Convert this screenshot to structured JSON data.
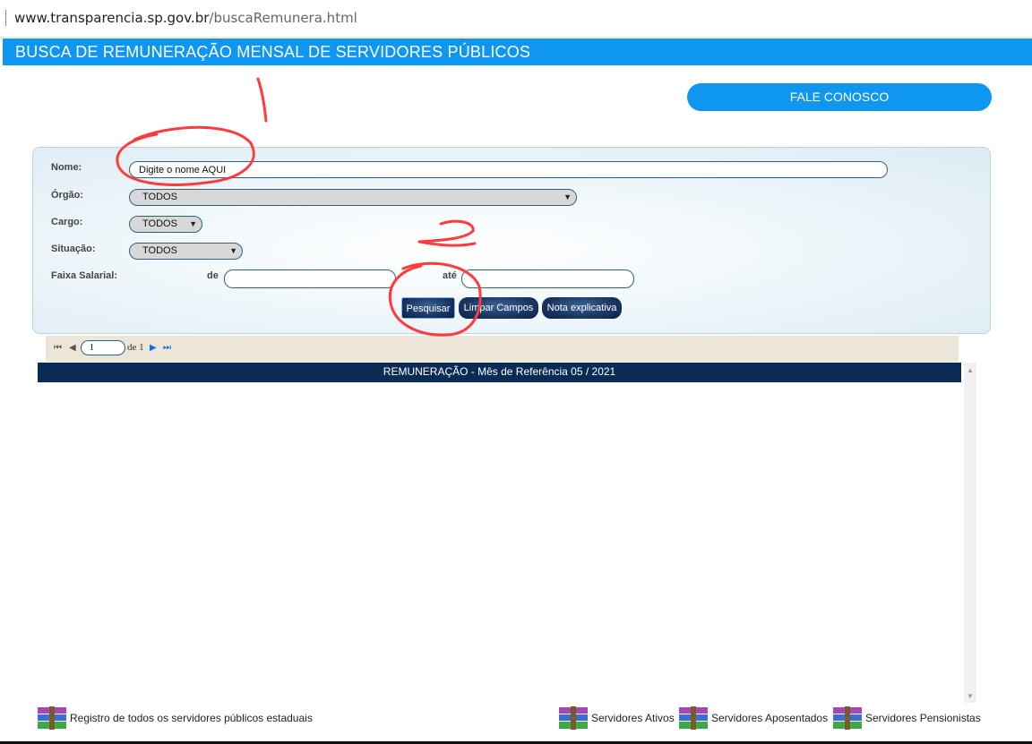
{
  "browser": {
    "url_domain": "www.transparencia.sp.gov.br",
    "url_path": "/buscaRemunera.html"
  },
  "header": {
    "title": "BUSCA DE REMUNERAÇÃO MENSAL DE SERVIDORES PÚBLICOS",
    "contact_button": "FALE CONOSCO"
  },
  "form": {
    "nome_label": "Nome:",
    "nome_value": "Digite o nome AQUI",
    "orgao_label": "Órgão:",
    "orgao_value": "TODOS",
    "cargo_label": "Cargo:",
    "cargo_value": "TODOS",
    "situacao_label": "Situação:",
    "situacao_value": "TODOS",
    "faixa_label": "Faixa Salarial:",
    "de_label": "de",
    "ate_label": "até",
    "de_value": "",
    "ate_value": "",
    "buttons": {
      "search": "Pesquisar",
      "clear": "Limpar Campos",
      "note": "Nota explicativa"
    }
  },
  "pager": {
    "page_value": "1",
    "of_label": "de 1"
  },
  "grid": {
    "header": "REMUNERAÇÃO - Mês de Referência 05 / 2021"
  },
  "footer": {
    "all_registry": "Registro de todos os servidores públicos estaduais",
    "active": "Servidores Ativos",
    "retired": "Servidores Aposentados",
    "pensioners": "Servidores Pensionistas"
  },
  "annotations": {
    "mark1": "1",
    "mark2": "2",
    "color": "#ff3b3b"
  }
}
